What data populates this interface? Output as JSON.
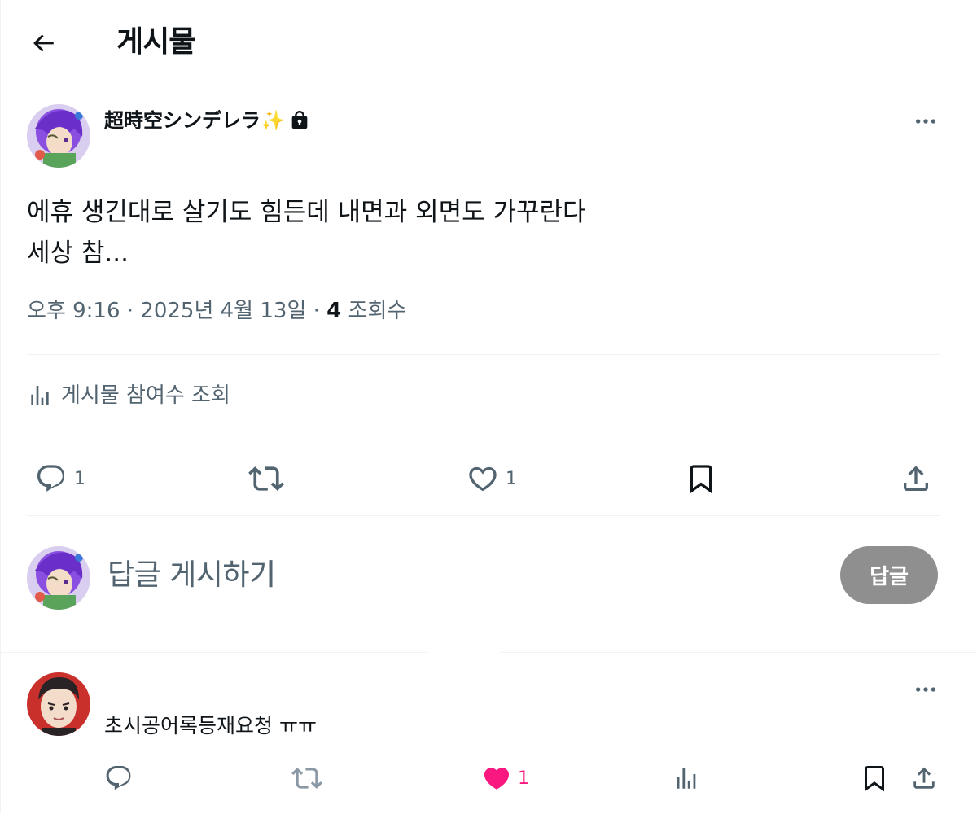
{
  "header": {
    "title": "게시물"
  },
  "post": {
    "author_name": "超時空シンデレラ✨",
    "text_lines": [
      "에휴 생긴대로 살기도 힘든데 내면과 외면도 가꾸란다",
      "세상 참..."
    ],
    "timestamp": "오후 9:16 · 2025년 4월 13일 · ",
    "views_count": "4",
    "views_label": " 조회수",
    "engagement_label": "게시물 참여수 조회",
    "reply_count": "1",
    "like_count": "1"
  },
  "reply_box": {
    "placeholder": "답글 게시하기",
    "button_label": "답글"
  },
  "reply": {
    "text": "초시공어록등재요청 ㅠㅠ",
    "like_count": "1"
  },
  "colors": {
    "text": "#0f1419",
    "muted": "#536471",
    "divider": "#eff3f4",
    "like_active": "#f91880",
    "button_disabled": "#8f8f8f"
  },
  "icons": [
    "back-arrow-icon",
    "lock-icon",
    "more-icon",
    "analytics-icon",
    "reply-icon",
    "retweet-icon",
    "heart-icon",
    "bookmark-icon",
    "share-icon"
  ]
}
